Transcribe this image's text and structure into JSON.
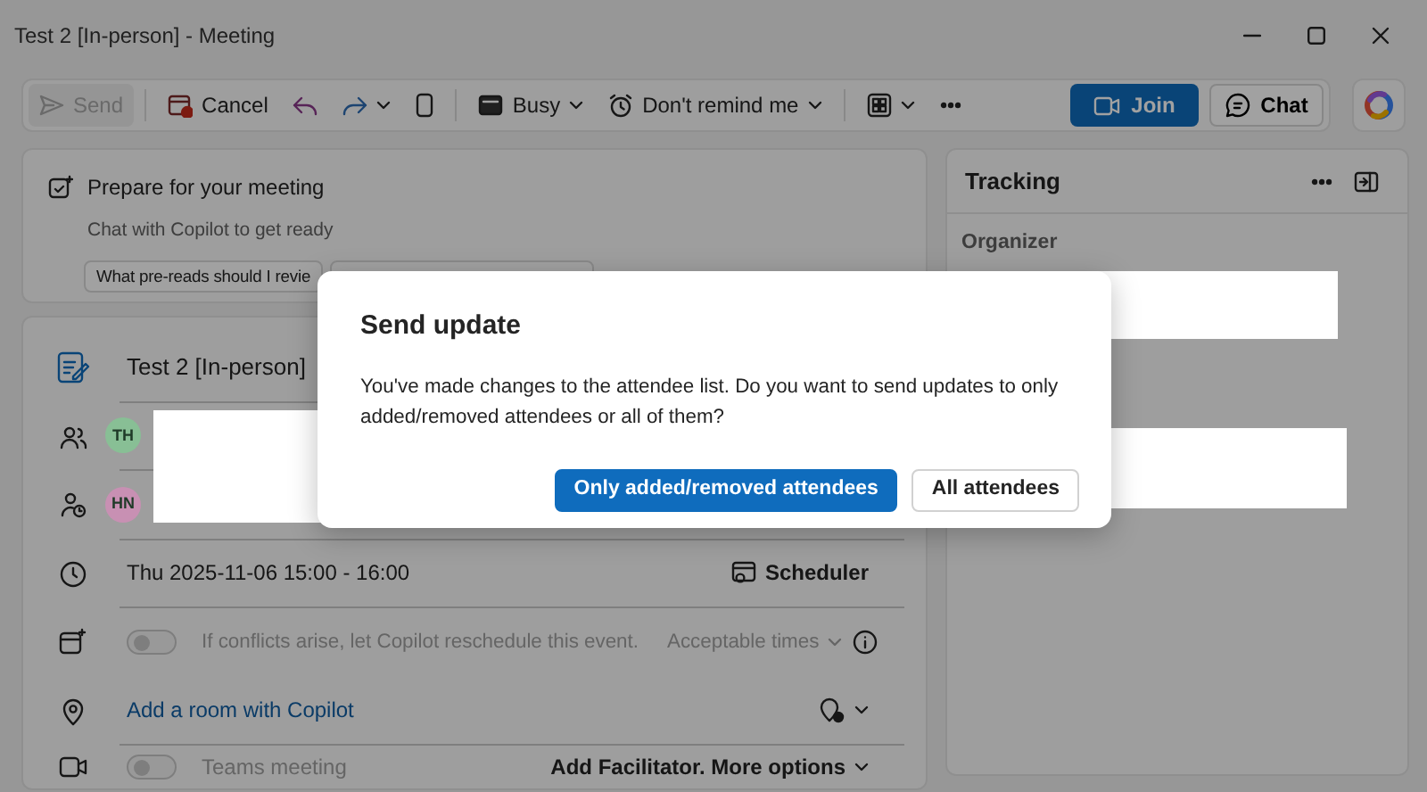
{
  "window": {
    "title": "Test 2 [In-person] - Meeting"
  },
  "toolbar": {
    "send": {
      "label": "Send",
      "disabled": true
    },
    "cancel": {
      "label": "Cancel"
    },
    "busy": {
      "label": "Busy"
    },
    "remind": {
      "label": "Don't remind me"
    },
    "join": {
      "label": "Join"
    },
    "chat": {
      "label": "Chat"
    }
  },
  "prepare": {
    "title": "Prepare for your meeting",
    "subtitle": "Chat with Copilot to get ready",
    "chips": [
      "What pre-reads should I revie"
    ]
  },
  "event": {
    "title": "Test 2 [In-person]",
    "attendees": [
      {
        "initials": "TH",
        "color": "#88bf95"
      },
      {
        "initials": "HN",
        "color": "#c890b3"
      }
    ],
    "time": "Thu 2025-11-06 15:00 - 16:00",
    "scheduler": "Scheduler",
    "reschedule": {
      "on": false,
      "text": "If conflicts arise, let Copilot reschedule this event.",
      "option": "Acceptable times"
    },
    "location": {
      "link": "Add a room with Copilot"
    },
    "teams": {
      "on": false,
      "text": "Teams meeting",
      "options": "Add Facilitator. More options"
    }
  },
  "tracking": {
    "title": "Tracking",
    "organizer_label": "Organizer"
  },
  "dialog": {
    "title": "Send update",
    "body": "You've made changes to the attendee list. Do you want to send updates to only added/removed attendees or all of them?",
    "buttons": [
      {
        "label": "Only added/removed attendees",
        "primary": true
      },
      {
        "label": "All attendees",
        "primary": false
      }
    ]
  }
}
